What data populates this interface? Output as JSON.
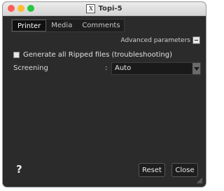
{
  "window": {
    "title": "Topi-5",
    "app_icon_glyph": "X"
  },
  "tabs": [
    {
      "label": "Printer",
      "active": true
    },
    {
      "label": "Media",
      "active": false
    },
    {
      "label": "Comments",
      "active": false
    }
  ],
  "advanced": {
    "label": "Advanced parameters",
    "toggle_icon": "minus-icon"
  },
  "options": {
    "generate_ripped_label": "Generate all Ripped files (troubleshooting)",
    "generate_ripped_checked": false
  },
  "screening": {
    "label": "Screening",
    "separator": ":",
    "value": "Auto"
  },
  "footer": {
    "help_label": "?",
    "reset_label": "Reset",
    "close_label": "Close"
  },
  "colors": {
    "background": "#2b2b2b",
    "text": "#e0e0e0",
    "traffic_close": "#fc5f57",
    "traffic_minimize": "#fdbc2e",
    "traffic_maximize": "#28c840"
  }
}
